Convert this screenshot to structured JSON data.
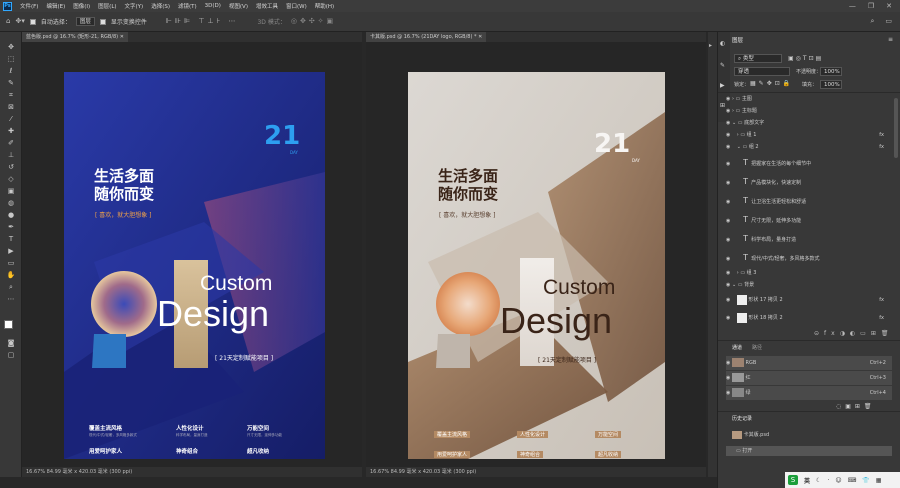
{
  "app": {
    "logo": "Ps"
  },
  "menu": [
    "文件(F)",
    "编辑(E)",
    "图像(I)",
    "图层(L)",
    "文字(Y)",
    "选择(S)",
    "滤镜(T)",
    "3D(D)",
    "视图(V)",
    "增效工具",
    "窗口(W)",
    "帮助(H)"
  ],
  "window_controls": [
    "—",
    "❐",
    "✕"
  ],
  "options": {
    "auto_select": "自动选择：",
    "group_value": "图层",
    "show_transform": "显示变换控件",
    "mode3d": "3D 模式："
  },
  "tools": [
    "move",
    "marquee",
    "lasso",
    "quick-select",
    "crop",
    "frame",
    "eyedropper",
    "heal",
    "brush",
    "stamp",
    "history-brush",
    "eraser",
    "gradient",
    "blur",
    "dodge",
    "pen",
    "type",
    "path-select",
    "rectangle",
    "hand",
    "zoom",
    "more"
  ],
  "doc1": {
    "tab": "蓝色版.psd @ 16.7% (矩形-21, RGB/8)",
    "status": "16.67%   84.99 毫米 x 420.03 毫米 (300 ppi)",
    "title1": "生活多面",
    "title2": "随你而变",
    "tagline": "[ 喜欢，就大胆想象 ]",
    "brand_num": "21",
    "brand_sub": "DAY",
    "custom": "Custom",
    "design": "Design",
    "project": "[ 21天定制赋能项目 ]",
    "features": [
      {
        "head": "覆盖主流风格",
        "sub": "现代/中式/轻奢，多风格多款式"
      },
      {
        "head": "人性化设计",
        "sub": "科学布局，量身打造"
      },
      {
        "head": "万能空间",
        "sub": "尺寸无限，延伸多功能"
      },
      {
        "head": "用爱呵护家人",
        "sub": "让卫浴生活更轻松和舒适"
      },
      {
        "head": "神奇组合",
        "sub": "产品模块化，快速定制"
      },
      {
        "head": "超凡收纳",
        "sub": "把握家在生活的每个细节中"
      }
    ]
  },
  "doc2": {
    "tab": "卡其版.psd @ 16.7% (21DAY logo, RGB/8) *",
    "status": "16.67%   84.99 毫米 x 420.03 毫米 (300 ppi)",
    "title1": "生活多面",
    "title2": "随你而变",
    "tagline": "[ 喜欢，就大胆想象 ]",
    "brand_num": "21",
    "brand_sub": "DAY",
    "custom": "Custom",
    "design": "Design",
    "project": "[ 21天定制赋能项目 ]",
    "features": [
      {
        "head": "覆盖主流风格",
        "sub": "现代/中式/轻奢，多风格多款式"
      },
      {
        "head": "人性化设计",
        "sub": "科学布局，量身打造"
      },
      {
        "head": "万能空间",
        "sub": "尺寸无限，延伸多功能"
      },
      {
        "head": "用爱呵护家人",
        "sub": "让卫浴生活更轻松和舒适"
      },
      {
        "head": "神奇组合",
        "sub": "产品模块化，快速定制"
      },
      {
        "head": "超凡收纳",
        "sub": "把握家在生活的每个细节中"
      }
    ]
  },
  "layers_panel": {
    "title": "图层",
    "filter": "类型",
    "blend": "穿透",
    "opacity_label": "不透明度：",
    "opacity": "100%",
    "lock_label": "锁定：",
    "fill_label": "填充：",
    "fill": "100%",
    "layers": [
      {
        "name": "主图",
        "kind": "folder"
      },
      {
        "name": "主标题",
        "kind": "folder"
      },
      {
        "name": "底部文字",
        "kind": "folder"
      },
      {
        "name": "组 1",
        "kind": "folder",
        "fx": "fx"
      },
      {
        "name": "组 2",
        "kind": "folder",
        "fx": "fx"
      },
      {
        "name": "把握家在生活的每个细节中",
        "kind": "text"
      },
      {
        "name": "产品模块化，快速定制",
        "kind": "text"
      },
      {
        "name": "让卫浴生活更轻松和舒适",
        "kind": "text"
      },
      {
        "name": "尺寸无限，延伸多功能",
        "kind": "text"
      },
      {
        "name": "科学布局，量身打造",
        "kind": "text"
      },
      {
        "name": "现代/中式/轻奢，多风格多款式",
        "kind": "text"
      },
      {
        "name": "组 3",
        "kind": "folder"
      },
      {
        "name": "背景",
        "kind": "folder"
      },
      {
        "name": "形状 17 拷贝 2",
        "kind": "shape",
        "fx": "fx"
      },
      {
        "name": "形状 18 拷贝 2",
        "kind": "shape",
        "fx": "fx"
      }
    ]
  },
  "channels_panel": {
    "tabs": [
      "通道",
      "路径"
    ],
    "channels": [
      {
        "name": "RGB",
        "shortcut": "Ctrl+2"
      },
      {
        "name": "红",
        "shortcut": "Ctrl+3"
      },
      {
        "name": "绿",
        "shortcut": "Ctrl+4"
      }
    ]
  },
  "history_panel": {
    "title": "历史记录",
    "snapshot": "卡其版.psd",
    "items": [
      "打开"
    ]
  },
  "taskbar": {
    "ime": "S",
    "lang": "英"
  },
  "colors": {
    "accent": "#31a8ff",
    "poster1_bg": "#202980",
    "poster1_text": "#ffffff",
    "poster1_accent": "#f0a24a",
    "poster2_bg": "#d2cdc7",
    "poster2_text": "#3a2418",
    "poster2_label_bg": "#b48a63"
  }
}
